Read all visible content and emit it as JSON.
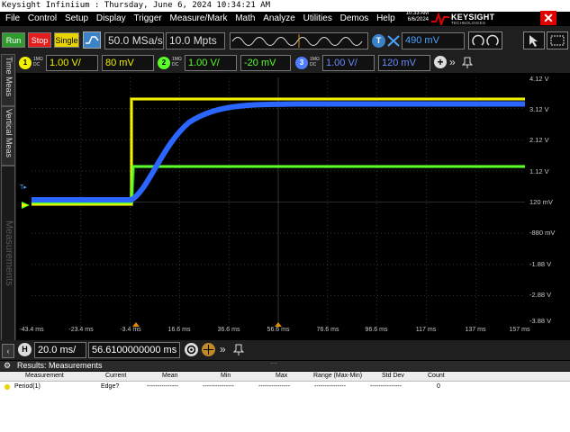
{
  "title_bar": "Keysight Infiniium : Thursday, June 6, 2024 10:34:21 AM",
  "menu": [
    "File",
    "Control",
    "Setup",
    "Display",
    "Trigger",
    "Measure/Mark",
    "Math",
    "Analyze",
    "Utilities",
    "Demos",
    "Help"
  ],
  "clock": {
    "time": "10:33 AM",
    "date": "6/6/2024"
  },
  "logo": {
    "name": "KEYSIGHT",
    "sub": "TECHNOLOGIES"
  },
  "close_label": "✕",
  "acq": {
    "run": "Run",
    "stop": "Stop",
    "single": "Single",
    "sample_rate": "50.0 MSa/s",
    "memory_depth": "10.0 Mpts",
    "trigger_source": "T",
    "trigger_level": "490 mV"
  },
  "channels": [
    {
      "num": "1",
      "coupling": "1MΩ DC",
      "scale": "1.00 V/",
      "offset": "80 mV",
      "color": "#f2f200"
    },
    {
      "num": "2",
      "coupling": "1MΩ DC",
      "scale": "1.00 V/",
      "offset": "-20 mV",
      "color": "#58ff2a"
    },
    {
      "num": "3",
      "coupling": "1MΩ DC",
      "scale": "1.00 V/",
      "offset": "120 mV",
      "color": "#2a66ff"
    }
  ],
  "side_tabs": {
    "time": "Time Meas",
    "vertical": "Vertical Meas",
    "measurements": "Measurements"
  },
  "y_axis": [
    "4.12 V",
    "3.12 V",
    "2.12 V",
    "1.12 V",
    "120 mV",
    "-880 mV",
    "-1.88 V",
    "-2.88 V",
    "-3.88 V"
  ],
  "x_axis": [
    "-43.4 ms",
    "-23.4 ms",
    "-3.4 ms",
    "16.6 ms",
    "36.6 ms",
    "56.6 ms",
    "76.6 ms",
    "96.6 ms",
    "117 ms",
    "137 ms",
    "157 ms"
  ],
  "timebase": {
    "channel": "H",
    "scale": "20.0 ms/",
    "position": "56.6100000000 ms"
  },
  "results": {
    "title": "Results: Measurements",
    "headers": [
      "Measurement",
      "Current",
      "Mean",
      "Min",
      "Max",
      "Range (Max-Min)",
      "Std Dev",
      "Count"
    ],
    "row": [
      "Period(1)",
      "Edge?",
      "---------------",
      "---------------",
      "---------------",
      "---------------",
      "---------------",
      "0"
    ]
  }
}
